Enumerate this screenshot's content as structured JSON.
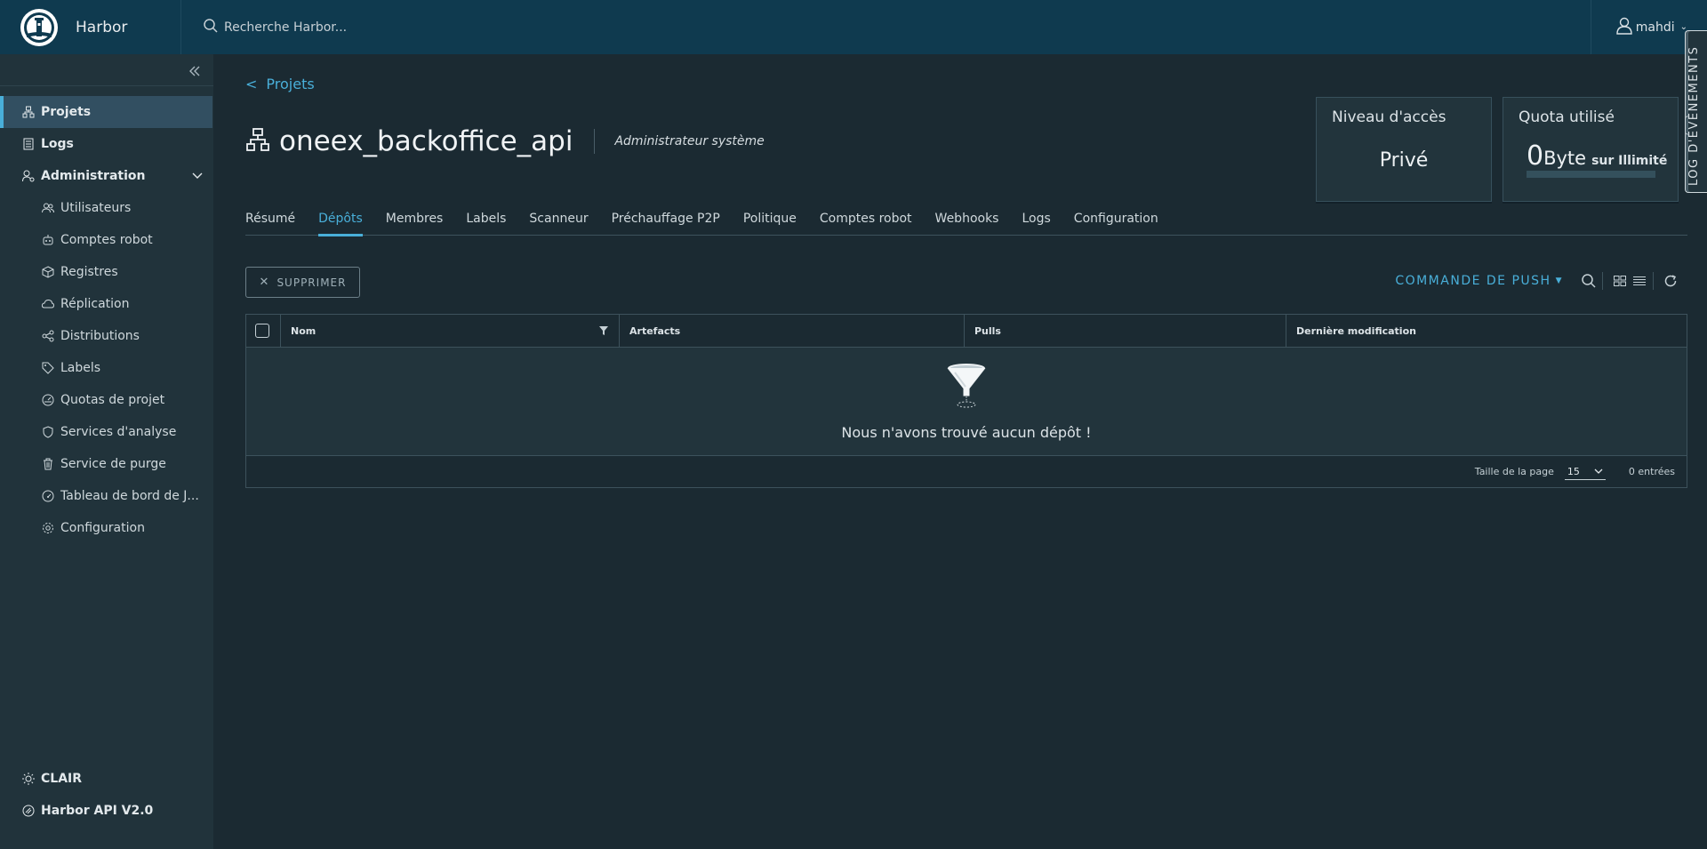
{
  "header": {
    "brand": "Harbor",
    "search_placeholder": "Recherche Harbor...",
    "username": "mahdi"
  },
  "sidebar": {
    "items": [
      {
        "label": "Projets",
        "icon": "projects-icon"
      },
      {
        "label": "Logs",
        "icon": "logs-icon"
      },
      {
        "label": "Administration",
        "icon": "administration-icon"
      }
    ],
    "admin_items": [
      {
        "label": "Utilisateurs",
        "icon": "users-icon"
      },
      {
        "label": "Comptes robot",
        "icon": "robot-icon"
      },
      {
        "label": "Registres",
        "icon": "registry-icon"
      },
      {
        "label": "Réplication",
        "icon": "replication-icon"
      },
      {
        "label": "Distributions",
        "icon": "distributions-icon"
      },
      {
        "label": "Labels",
        "icon": "labels-icon"
      },
      {
        "label": "Quotas de projet",
        "icon": "quota-icon"
      },
      {
        "label": "Services d'analyse",
        "icon": "shield-icon"
      },
      {
        "label": "Service de purge",
        "icon": "trash-icon"
      },
      {
        "label": "Tableau de bord de J...",
        "icon": "dashboard-icon"
      },
      {
        "label": "Configuration",
        "icon": "gear-icon"
      }
    ],
    "bottom": [
      {
        "label": "CLAIR",
        "icon": "sun-icon"
      },
      {
        "label": "Harbor API V2.0",
        "icon": "api-icon"
      }
    ]
  },
  "breadcrumb": {
    "lt": "<",
    "label": "Projets"
  },
  "project": {
    "name": "oneex_backoffice_api",
    "role": "Administrateur système"
  },
  "cards": {
    "access": {
      "title": "Niveau d'accès",
      "value": "Privé"
    },
    "quota": {
      "title": "Quota utilisé",
      "amount": "0",
      "unit": "Byte",
      "suffix": "sur Illimité",
      "used_fraction": 0
    }
  },
  "tabs": [
    "Résumé",
    "Dépôts",
    "Membres",
    "Labels",
    "Scanneur",
    "Préchauffage P2P",
    "Politique",
    "Comptes robot",
    "Webhooks",
    "Logs",
    "Configuration"
  ],
  "active_tab": "Dépôts",
  "actions": {
    "delete": "SUPPRIMER",
    "push_command": "COMMANDE DE PUSH"
  },
  "grid": {
    "columns": [
      "Nom",
      "Artefacts",
      "Pulls",
      "Dernière modification"
    ],
    "empty_message": "Nous n'avons trouvé aucun dépôt !",
    "page_size_label": "Taille de la page",
    "page_size": "15",
    "entries": "0 entrées"
  },
  "event_log": "LOG D'ÉVÈNEMENTS",
  "colors": {
    "accent": "#49afd9",
    "header": "#0f3a4f",
    "sidebar": "#21333b",
    "content": "#1b2a32"
  }
}
